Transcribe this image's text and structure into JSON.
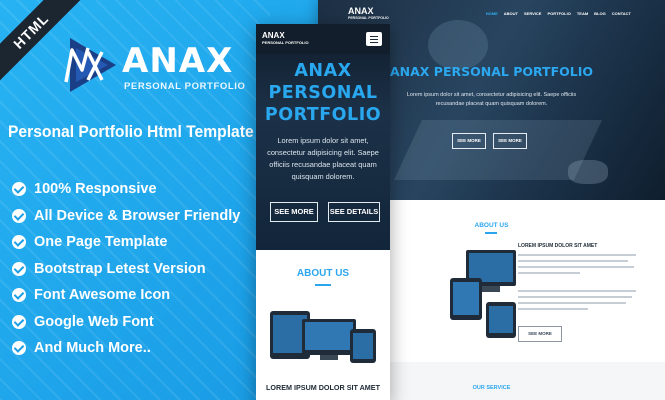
{
  "badge": "HTML",
  "logo": {
    "title": "ANAX",
    "subtitle": "PERSONAL PORTFOLIO"
  },
  "tagline": "Personal Portfolio Html Template",
  "features": [
    "100% Responsive",
    "All Device & Browser Friendly",
    "One Page Template",
    "Bootstrap Letest Version",
    "Font Awesome Icon",
    "Google Web Font",
    "And Much More.."
  ],
  "mobile": {
    "brand": "ANAX",
    "brand_sub": "PERSONAL PORTFOLIO",
    "title_line1": "ANAX",
    "title_line2": "PERSONAL",
    "title_line3": "PORTFOLIO",
    "text": "Lorem ipsum dolor sit amet, consectetur adipisicing elit. Saepe officiis recusandae placeat quam quisquam dolorem.",
    "btn_more": "SEE MORE",
    "btn_details": "SEE DETAILS",
    "about": "ABOUT US",
    "lorem_heading": "LOREM IPSUM DOLOR SIT AMET"
  },
  "desktop": {
    "brand": "ANAX",
    "brand_sub": "PERSONAL PORTFOLIO",
    "menu": [
      "HOME",
      "ABOUT",
      "SERVICE",
      "PORTFOLIO",
      "TEAM",
      "BLOG",
      "CONTACT"
    ],
    "title": "ANAX PERSONAL PORTFOLIO",
    "text_line1": "Lorem ipsum dolor sit amet, consectetur adipisicing elit. Saepe officiis",
    "text_line2": "recusandae placeat quam quisquam dolorem.",
    "btn_more": "SEE MORE",
    "btn_details": "SEE MORE",
    "about": "ABOUT US",
    "sub_heading": "LOREM IPSUM DOLOR SIT AMET",
    "see_more": "SEE MORE",
    "service": "OUR SERVICE"
  },
  "colors": {
    "accent": "#2ba6ee",
    "background": "#1da2ea",
    "dark": "#1c2630"
  }
}
